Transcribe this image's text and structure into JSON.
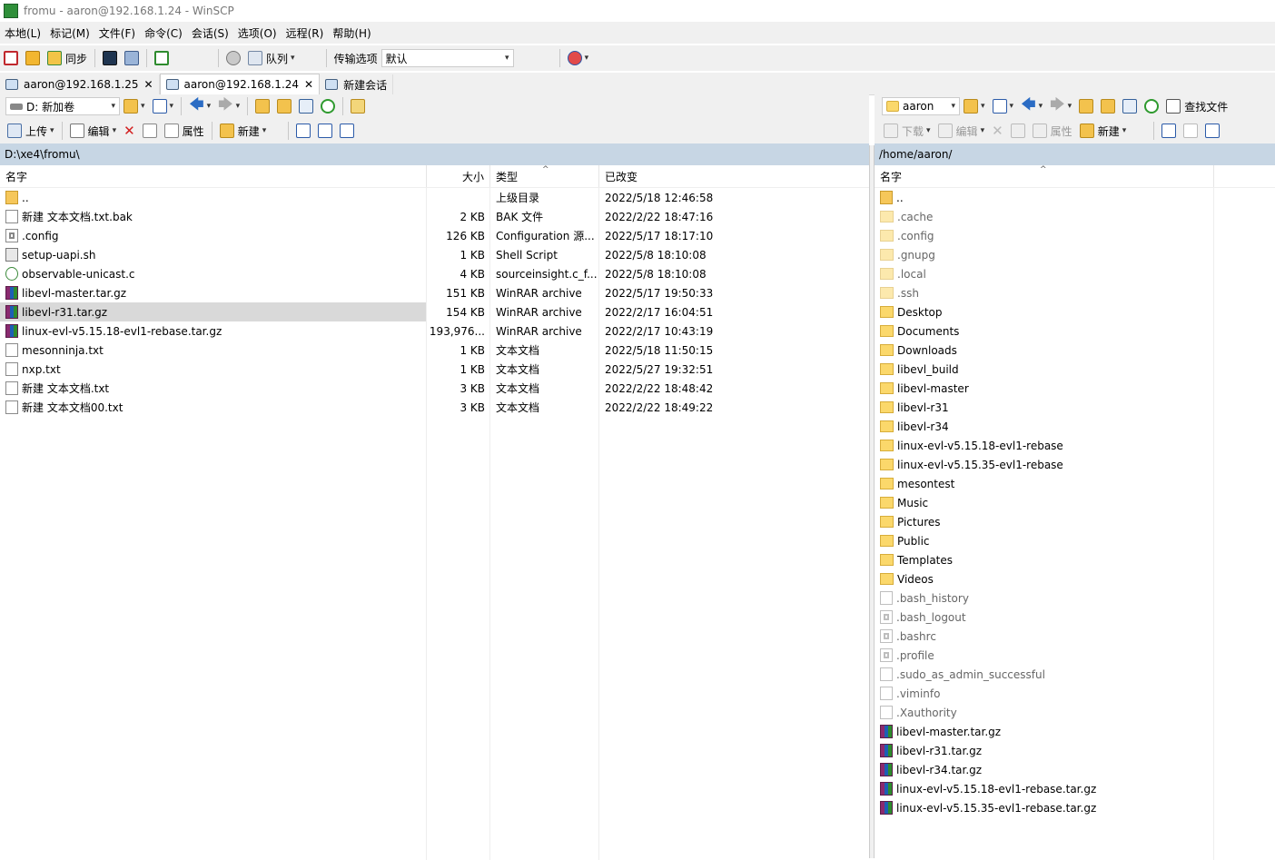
{
  "window": {
    "title": "fromu - aaron@192.168.1.24 - WinSCP"
  },
  "menu": [
    "本地(L)",
    "标记(M)",
    "文件(F)",
    "命令(C)",
    "会话(S)",
    "选项(O)",
    "远程(R)",
    "帮助(H)"
  ],
  "toolbar": {
    "sync_label": "同步",
    "queue_label": "队列",
    "transfer_label": "传输选项",
    "transfer_value": "默认"
  },
  "tabs": [
    {
      "label": "aaron@192.168.1.25"
    },
    {
      "label": "aaron@192.168.1.24"
    },
    {
      "label": "新建会话"
    }
  ],
  "local": {
    "drive": "D: 新加卷",
    "upload_label": "上传",
    "edit_label": "编辑",
    "properties_label": "属性",
    "new_label": "新建",
    "path": "D:\\xe4\\fromu\\",
    "columns": {
      "name": "名字",
      "size": "大小",
      "type": "类型",
      "modified": "已改变"
    },
    "files": [
      {
        "name": "..",
        "size": "",
        "type": "上级目录",
        "modified": "2022/5/18  12:46:58",
        "icon": "up"
      },
      {
        "name": "新建 文本文档.txt.bak",
        "size": "2 KB",
        "type": "BAK 文件",
        "modified": "2022/2/22  18:47:16",
        "icon": "doc"
      },
      {
        "name": ".config",
        "size": "126 KB",
        "type": "Configuration 源...",
        "modified": "2022/5/17  18:17:10",
        "icon": "cfg"
      },
      {
        "name": "setup-uapi.sh",
        "size": "1 KB",
        "type": "Shell Script",
        "modified": "2022/5/8  18:10:08",
        "icon": "sh"
      },
      {
        "name": "observable-unicast.c",
        "size": "4 KB",
        "type": "sourceinsight.c_f...",
        "modified": "2022/5/8  18:10:08",
        "icon": "c"
      },
      {
        "name": "libevl-master.tar.gz",
        "size": "151 KB",
        "type": "WinRAR archive",
        "modified": "2022/5/17  19:50:33",
        "icon": "rar"
      },
      {
        "name": "libevl-r31.tar.gz",
        "size": "154 KB",
        "type": "WinRAR archive",
        "modified": "2022/2/17  16:04:51",
        "icon": "rar"
      },
      {
        "name": "linux-evl-v5.15.18-evl1-rebase.tar.gz",
        "size": "193,976...",
        "type": "WinRAR archive",
        "modified": "2022/2/17  10:43:19",
        "icon": "rar"
      },
      {
        "name": "mesonninja.txt",
        "size": "1 KB",
        "type": "文本文档",
        "modified": "2022/5/18  11:50:15",
        "icon": "doc"
      },
      {
        "name": "nxp.txt",
        "size": "1 KB",
        "type": "文本文档",
        "modified": "2022/5/27  19:32:51",
        "icon": "doc"
      },
      {
        "name": "新建 文本文档.txt",
        "size": "3 KB",
        "type": "文本文档",
        "modified": "2022/2/22  18:48:42",
        "icon": "doc"
      },
      {
        "name": "新建 文本文档00.txt",
        "size": "3 KB",
        "type": "文本文档",
        "modified": "2022/2/22  18:49:22",
        "icon": "doc"
      }
    ]
  },
  "remote": {
    "dir_combo": "aaron",
    "find_label": "查找文件",
    "download_label": "下载",
    "edit_label": "编辑",
    "properties_label": "属性",
    "new_label": "新建",
    "path": "/home/aaron/",
    "columns": {
      "name": "名字"
    },
    "files": [
      {
        "name": "..",
        "icon": "up",
        "faded": false
      },
      {
        "name": ".cache",
        "icon": "folder",
        "faded": true
      },
      {
        "name": ".config",
        "icon": "folder",
        "faded": true
      },
      {
        "name": ".gnupg",
        "icon": "folder",
        "faded": true
      },
      {
        "name": ".local",
        "icon": "folder",
        "faded": true
      },
      {
        "name": ".ssh",
        "icon": "folder",
        "faded": true
      },
      {
        "name": "Desktop",
        "icon": "folder",
        "faded": false
      },
      {
        "name": "Documents",
        "icon": "folder",
        "faded": false
      },
      {
        "name": "Downloads",
        "icon": "folder",
        "faded": false
      },
      {
        "name": "libevl_build",
        "icon": "folder",
        "faded": false
      },
      {
        "name": "libevl-master",
        "icon": "folder",
        "faded": false
      },
      {
        "name": "libevl-r31",
        "icon": "folder",
        "faded": false
      },
      {
        "name": "libevl-r34",
        "icon": "folder",
        "faded": false
      },
      {
        "name": "linux-evl-v5.15.18-evl1-rebase",
        "icon": "folder",
        "faded": false
      },
      {
        "name": "linux-evl-v5.15.35-evl1-rebase",
        "icon": "folder",
        "faded": false
      },
      {
        "name": "mesontest",
        "icon": "folder",
        "faded": false
      },
      {
        "name": "Music",
        "icon": "folder",
        "faded": false
      },
      {
        "name": "Pictures",
        "icon": "folder",
        "faded": false
      },
      {
        "name": "Public",
        "icon": "folder",
        "faded": false
      },
      {
        "name": "Templates",
        "icon": "folder",
        "faded": false
      },
      {
        "name": "Videos",
        "icon": "folder",
        "faded": false
      },
      {
        "name": ".bash_history",
        "icon": "doc",
        "faded": true
      },
      {
        "name": ".bash_logout",
        "icon": "cfg",
        "faded": true
      },
      {
        "name": ".bashrc",
        "icon": "cfg",
        "faded": true
      },
      {
        "name": ".profile",
        "icon": "cfg",
        "faded": true
      },
      {
        "name": ".sudo_as_admin_successful",
        "icon": "doc",
        "faded": true
      },
      {
        "name": ".viminfo",
        "icon": "doc",
        "faded": true
      },
      {
        "name": ".Xauthority",
        "icon": "doc",
        "faded": true
      },
      {
        "name": "libevl-master.tar.gz",
        "icon": "rar",
        "faded": false
      },
      {
        "name": "libevl-r31.tar.gz",
        "icon": "rar",
        "faded": false
      },
      {
        "name": "libevl-r34.tar.gz",
        "icon": "rar",
        "faded": false
      },
      {
        "name": "linux-evl-v5.15.18-evl1-rebase.tar.gz",
        "icon": "rar",
        "faded": false
      },
      {
        "name": "linux-evl-v5.15.35-evl1-rebase.tar.gz",
        "icon": "rar",
        "faded": false
      }
    ]
  },
  "selected_local_row": "libevl-r31.tar.gz",
  "colors": {
    "pathbar": "#c7d6e4",
    "selection": "#d9d9d9",
    "chrome": "#f0f0f0"
  }
}
